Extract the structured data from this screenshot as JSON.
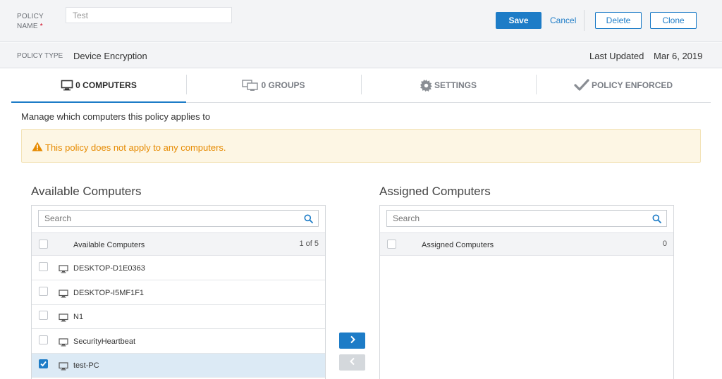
{
  "header": {
    "policy_name_label_line1": "POLICY",
    "policy_name_label_line2": "NAME",
    "required_marker": "*",
    "policy_name_value": "Test",
    "save_label": "Save",
    "cancel_label": "Cancel",
    "delete_label": "Delete",
    "clone_label": "Clone"
  },
  "typebar": {
    "policy_type_label": "POLICY TYPE",
    "policy_type_value": "Device Encryption",
    "last_updated_label": "Last Updated",
    "last_updated_value": "Mar 6, 2019"
  },
  "tabs": [
    {
      "label": "0 COMPUTERS",
      "icon": "monitor-icon",
      "active": true
    },
    {
      "label": "0 GROUPS",
      "icon": "monitors-group-icon",
      "active": false
    },
    {
      "label": "SETTINGS",
      "icon": "gear-icon",
      "active": false
    },
    {
      "label": "POLICY ENFORCED",
      "icon": "checkmark-icon",
      "active": false
    }
  ],
  "main": {
    "manage_text": "Manage which computers this policy applies to",
    "warning_text": "This policy does not apply to any computers."
  },
  "available": {
    "title": "Available Computers",
    "search_placeholder": "Search",
    "header_label": "Available Computers",
    "count": "1 of 5",
    "rows": [
      {
        "name": "DESKTOP-D1E0363",
        "checked": false
      },
      {
        "name": "DESKTOP-I5MF1F1",
        "checked": false
      },
      {
        "name": "N1",
        "checked": false
      },
      {
        "name": "SecurityHeartbeat",
        "checked": false
      },
      {
        "name": "test-PC",
        "checked": true
      }
    ]
  },
  "assigned": {
    "title": "Assigned Computers",
    "search_placeholder": "Search",
    "header_label": "Assigned Computers",
    "count": "0"
  },
  "colors": {
    "accent": "#1d7cc7",
    "warning_text": "#e68a00",
    "warning_bg": "#fdf6e4",
    "selected_row": "#dceaf5"
  }
}
